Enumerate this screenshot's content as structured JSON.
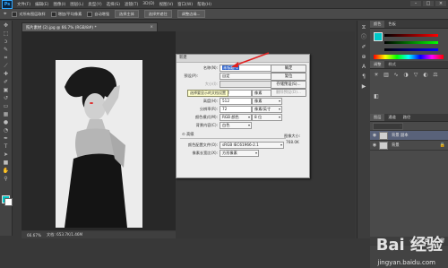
{
  "menubar": {
    "logo": "Ps",
    "items": [
      "文件(F)",
      "编辑(E)",
      "图像(I)",
      "图层(L)",
      "类型(Y)",
      "选择(S)",
      "滤镜(T)",
      "3D(D)",
      "视图(V)",
      "窗口(W)",
      "帮助(H)"
    ],
    "min": "–",
    "max": "□",
    "close": "×"
  },
  "options": {
    "checks": [
      "对所有图层取样",
      "增加/平均像素",
      "自动增强",
      "调整边缘..."
    ],
    "buttons": [
      "选择主体",
      "选择并遮住",
      "调整边缘..."
    ]
  },
  "document": {
    "tab_title": "照片素材 (2).jpg @ 66.7% (RGB/8#) *",
    "zoom": "66.67%",
    "doc_info": "文档: 653.7K/1.46M"
  },
  "dialog": {
    "title": "新建",
    "name_label": "名称(N):",
    "name_value": "未标题-1",
    "preset_label": "预设(P):",
    "preset_value": "自定",
    "size_label": "大小(I):",
    "width_label": "宽度(W):",
    "width_value": "512",
    "width_unit": "像素",
    "height_label": "高度(H):",
    "height_value": "512",
    "height_unit": "像素",
    "resolution_label": "分辨率(R):",
    "resolution_value": "72",
    "resolution_unit": "像素/英寸",
    "colormode_label": "颜色模式(M):",
    "colormode_value": "RGB 颜色",
    "bitdepth_value": "8 位",
    "background_label": "背景内容(C):",
    "background_value": "白色",
    "advanced_label": "高级",
    "profile_label": "颜色配置文件(O):",
    "profile_value": "sRGB IEC61966-2.1",
    "aspect_label": "像素长宽比(X):",
    "aspect_value": "方形像素",
    "ok": "确定",
    "reset": "复位",
    "save_preset": "存储预设(S)...",
    "delete_preset": "删除预设(D)...",
    "image_size_label": "图像大小:",
    "image_size_value": "768.0K",
    "tooltip": "选择要显示的文档设置"
  },
  "panels": {
    "tabs_top": [
      "颜色",
      "色板"
    ],
    "tabs_mid": [
      "调整",
      "样式"
    ],
    "tabs_layers": [
      "图层",
      "通道",
      "路径"
    ],
    "layers": [
      {
        "name": "背景 副本"
      },
      {
        "name": "背景"
      }
    ]
  },
  "watermark": {
    "text": "Bai 经验",
    "url": "jingyan.baidu.com"
  }
}
